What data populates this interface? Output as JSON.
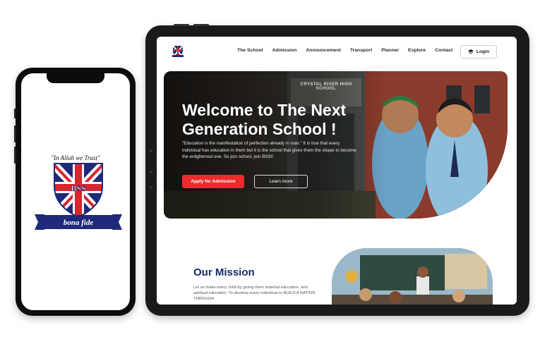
{
  "phone": {
    "motto": "\"In Allah we Trust\"",
    "crest_text": "BSS",
    "banner_text": "bona fide"
  },
  "tablet": {
    "nav": {
      "items": [
        "The School",
        "Admission",
        "Announcement",
        "Transport",
        "Planner",
        "Explore",
        "Contact"
      ],
      "login_label": "Login"
    },
    "hero": {
      "title": "Welcome to The Next Generation School !",
      "text": "\"Education is the manifestation of perfection already in man.\" It is true that every individual has education in them but it is the school that gives them the shape to become the enlightened one. So join school, join BSS!!",
      "apply_label": "Apply for Admission",
      "learn_label": "Learn more",
      "sign_text": "CRYSTAL RIVER HIGH SCHOOL"
    },
    "mission": {
      "title": "Our Mission",
      "text": "Let us make every child by giving them material education, and spiritual education. To develop every individual to BUILD A NATION THROUGH"
    }
  },
  "colors": {
    "accent_red": "#ec2b2b",
    "navy": "#182a68",
    "device_frame": "#1a1a1a"
  }
}
